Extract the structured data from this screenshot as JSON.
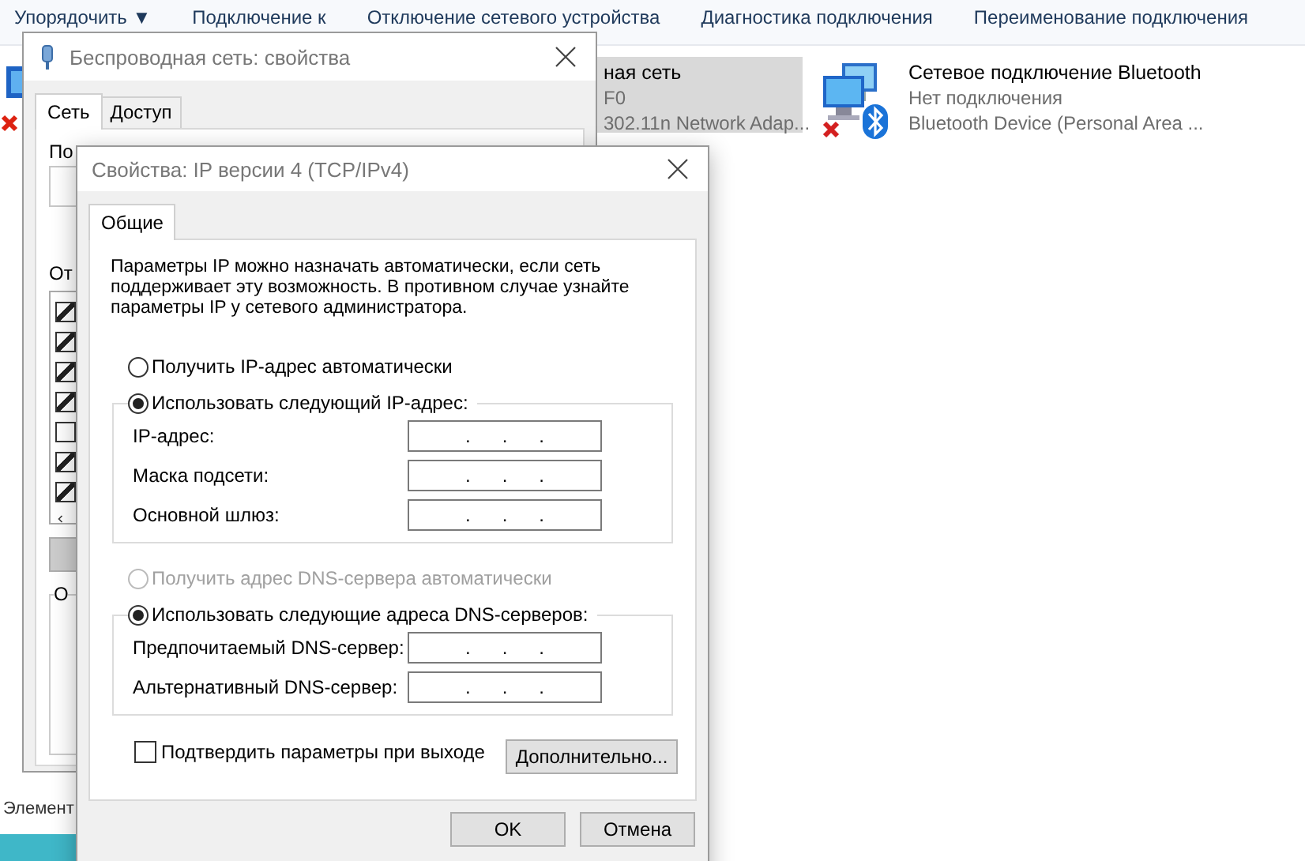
{
  "explorer": {
    "toolbar": [
      {
        "label": "Упорядочить ▼"
      },
      {
        "label": "Подключение к"
      },
      {
        "label": "Отключение сетевого устройства"
      },
      {
        "label": "Диагностика подключения"
      },
      {
        "label": "Переименование подключения"
      }
    ],
    "items": [
      {
        "kind": "partial",
        "name": "ная сеть",
        "status": "F0",
        "device": "302.11n Network Adap...",
        "selected": true
      },
      {
        "kind": "bluetooth",
        "name": "Сетевое подключение Bluetooth",
        "status": "Нет подключения",
        "device": "Bluetooth Device (Personal Area ...",
        "selected": false
      }
    ],
    "status_bar": "Элемент"
  },
  "back_dialog": {
    "title": "Беспроводная сеть: свойства",
    "tabs": [
      {
        "label": "Сеть",
        "selected": true
      },
      {
        "label": "Доступ",
        "selected": false
      }
    ],
    "connect_label": "По",
    "components_label": "От",
    "components": [
      {
        "checked": true
      },
      {
        "checked": true
      },
      {
        "checked": true
      },
      {
        "checked": true
      },
      {
        "checked": false
      },
      {
        "checked": true
      },
      {
        "checked": true
      }
    ],
    "group_label": "О"
  },
  "ipv4_dialog": {
    "title": "Свойства: IP версии 4 (TCP/IPv4)",
    "tabs": [
      {
        "label": "Общие",
        "selected": true
      }
    ],
    "description": "Параметры IP можно назначать автоматически, если сеть поддерживает эту возможность. В противном случае узнайте параметры IP у сетевого администратора.",
    "ip_mode": [
      {
        "label": "Получить IP-адрес автоматически",
        "selected": false,
        "disabled": false
      },
      {
        "label": "Использовать следующий IP-адрес:",
        "selected": true,
        "disabled": false
      }
    ],
    "ip_fields": [
      {
        "label": "IP-адрес:",
        "value": ".      .      ."
      },
      {
        "label": "Маска подсети:",
        "value": ".      .      ."
      },
      {
        "label": "Основной шлюз:",
        "value": ".      .      ."
      }
    ],
    "dns_mode": [
      {
        "label": "Получить адрес DNS-сервера автоматически",
        "selected": false,
        "disabled": true
      },
      {
        "label": "Использовать следующие адреса DNS-серверов:",
        "selected": true,
        "disabled": false
      }
    ],
    "dns_fields": [
      {
        "label": "Предпочитаемый DNS-сервер:",
        "value": ".      .      ."
      },
      {
        "label": "Альтернативный DNS-сервер:",
        "value": ".      .      ."
      }
    ],
    "confirm": {
      "label": "Подтвердить параметры при выходе",
      "checked": false
    },
    "advanced_button": "Дополнительно...",
    "buttons": [
      "OK",
      "Отмена"
    ]
  }
}
